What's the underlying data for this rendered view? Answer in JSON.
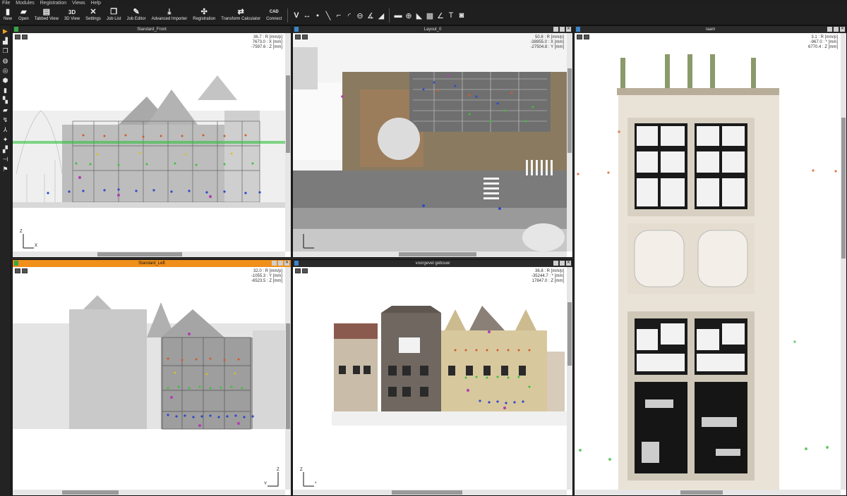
{
  "menu": [
    "File",
    "Modules",
    "Registration",
    "Views",
    "Help"
  ],
  "toolbar": {
    "buttons": [
      {
        "label": "New",
        "icon": "new-file-icon"
      },
      {
        "label": "Open",
        "icon": "open-folder-icon"
      },
      {
        "label": "Tabbed View",
        "icon": "tabbed-view-icon"
      },
      {
        "label": "3D View",
        "icon": "3d-view-icon",
        "glyph": "3D"
      },
      {
        "label": "Settings",
        "icon": "settings-tools-icon"
      },
      {
        "label": "Job List",
        "icon": "job-list-icon"
      },
      {
        "label": "Job Editor",
        "icon": "job-editor-icon"
      },
      {
        "label": "Advanced Importer",
        "icon": "download-icon"
      },
      {
        "label": "Registration",
        "icon": "registration-icon"
      },
      {
        "label": "Transform Calculator",
        "icon": "transform-icon"
      },
      {
        "label": "Connect",
        "icon": "cad-connect-icon",
        "glyph": "CAD"
      }
    ]
  },
  "views": {
    "standard_front": {
      "title": "Standard_Front",
      "readout": [
        "36.7 : R [mm/p]",
        "7673.0 : X [mm]",
        "-7597.6 : Z [mm]"
      ],
      "axis_up": "Z",
      "axis_right": "X"
    },
    "layout_0": {
      "title": "Layout_0",
      "readout": [
        "50.8 : R [mm/p]",
        "-38955.0 : X [mm]",
        "-27504.8 : Y [mm]"
      ]
    },
    "raam": {
      "title": "raam",
      "readout": [
        "3.1 : R [mm/p]",
        "-967.0 : * [mm]",
        "6770.4 : Z [mm]"
      ]
    },
    "standard_left": {
      "title": "Standard_Left",
      "readout": [
        "32.0 : R [mm/p]",
        "-1055.3 : Y [mm]",
        "-6523.5 : Z [mm]"
      ],
      "axis_up": "Z",
      "axis_right": "Y"
    },
    "voorgevel": {
      "title": "voorgevel gebouw",
      "readout": [
        "36.8 : R [mm/p]",
        "-35244.7 : * [mm]",
        "17847.0 : Z [mm]"
      ],
      "axis_up": "Z",
      "axis_right": "*"
    }
  }
}
